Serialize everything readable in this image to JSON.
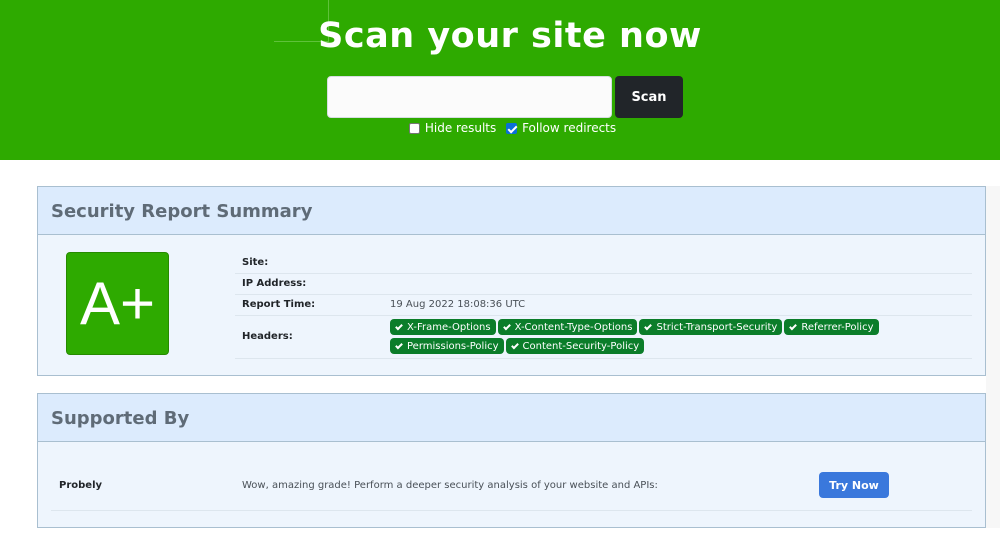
{
  "hero": {
    "title": "Scan your site now",
    "scan_input": {
      "value": "",
      "placeholder": ""
    },
    "scan_label": "Scan",
    "options": [
      {
        "label": "Hide results",
        "checked": false
      },
      {
        "label": "Follow redirects",
        "checked": true
      }
    ]
  },
  "summary": {
    "title": "Security Report Summary",
    "grade": "A+",
    "rows": {
      "site_label": "Site:",
      "site_value": "",
      "ip_label": "IP Address:",
      "ip_value": "",
      "time_label": "Report Time:",
      "time_value": "19 Aug 2022 18:08:36 UTC",
      "headers_label": "Headers:"
    },
    "headers": [
      "X-Frame-Options",
      "X-Content-Type-Options",
      "Strict-Transport-Security",
      "Referrer-Policy",
      "Permissions-Policy",
      "Content-Security-Policy"
    ]
  },
  "supported": {
    "title": "Supported By",
    "sponsor": "Probely",
    "text": "Wow, amazing grade! Perform a deeper security analysis of your website and APIs:",
    "button_label": "Try Now"
  },
  "colors": {
    "hero_green": "#2eaa00",
    "pill_green": "#0b7d2a",
    "button_dark": "#212529",
    "button_blue": "#3a78dc"
  }
}
